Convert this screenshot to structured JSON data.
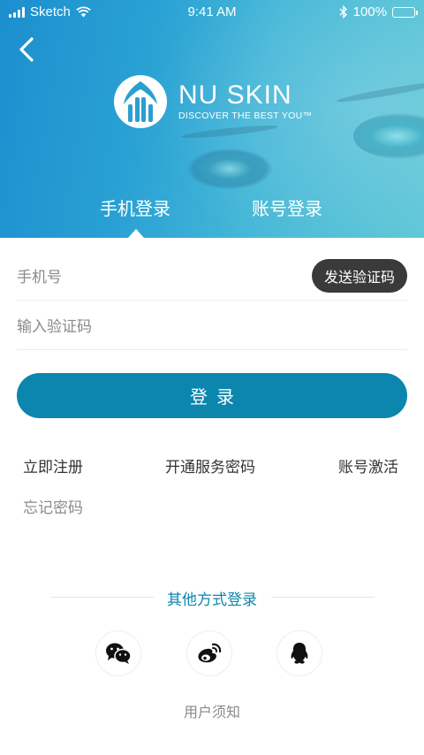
{
  "status_bar": {
    "carrier": "Sketch",
    "time": "9:41 AM",
    "battery": "100%"
  },
  "brand": {
    "name": "NU SKIN",
    "tagline": "DISCOVER THE BEST YOU™"
  },
  "tabs": [
    {
      "label": "手机登录",
      "active": true
    },
    {
      "label": "账号登录",
      "active": false
    }
  ],
  "form": {
    "phone_placeholder": "手机号",
    "code_placeholder": "输入验证码",
    "send_code_label": "发送验证码",
    "login_label": "登录"
  },
  "links": {
    "register": "立即注册",
    "open_service_password": "开通服务密码",
    "activate_account": "账号激活",
    "forgot_password": "忘记密码"
  },
  "other_login": {
    "title": "其他方式登录",
    "providers": [
      "wechat-icon",
      "weibo-icon",
      "qq-icon"
    ]
  },
  "user_notice": "用户须知",
  "colors": {
    "accent": "#0c86ad",
    "send_code_bg": "#3a3a3a",
    "hero": "#2aa2d4"
  }
}
